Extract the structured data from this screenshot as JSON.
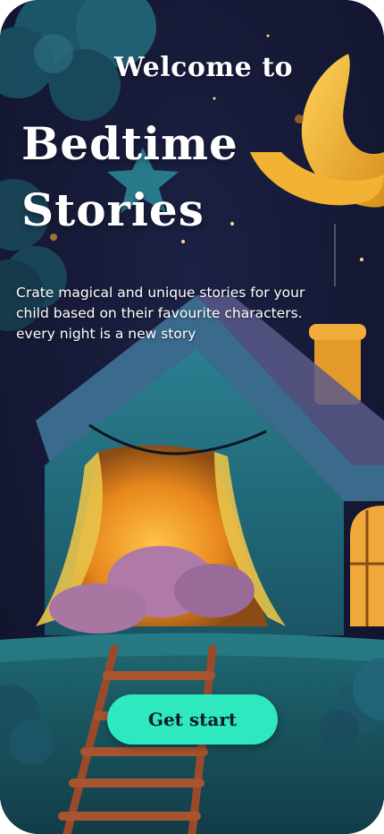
{
  "header": {
    "welcome": "Welcome to",
    "title_line1": "Bedtime",
    "title_line2": "Stories"
  },
  "description": {
    "line1": "Crate magical and unique stories for your",
    "line2": "child based on their favourite characters.",
    "line3": "every night is a new story"
  },
  "cta": {
    "label": "Get start"
  },
  "colors": {
    "accent": "#2ee8c0",
    "background": "#141a33",
    "moon": "#f2b233",
    "lamp_glow": "#ffb83a"
  }
}
